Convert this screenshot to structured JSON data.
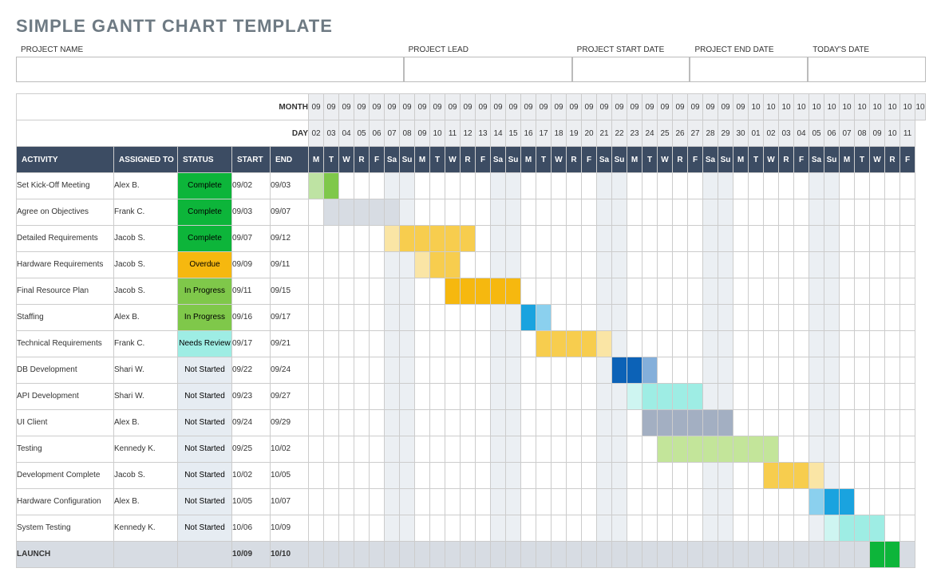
{
  "title": "SIMPLE GANTT CHART TEMPLATE",
  "meta_labels": {
    "project_name": "PROJECT NAME",
    "project_lead": "PROJECT LEAD",
    "start_date": "PROJECT START DATE",
    "end_date": "PROJECT END DATE",
    "today": "TODAY'S DATE"
  },
  "row_labels": {
    "month": "MONTH",
    "day": "DAY"
  },
  "column_headers": {
    "activity": "ACTIVITY",
    "assigned": "ASSIGNED TO",
    "status": "STATUS",
    "start": "START",
    "end": "END"
  },
  "status_colors": {
    "Complete": "#0db53a",
    "Overdue": "#f6b80f",
    "In Progress": "#7fc84a",
    "Needs Review": "#9eede4",
    "Not Started": "#e6ecf2"
  },
  "chart_data": {
    "type": "bar",
    "timeline": {
      "start": "09/02",
      "end": "10/11",
      "months": [
        "09",
        "09",
        "09",
        "09",
        "09",
        "09",
        "09",
        "09",
        "09",
        "09",
        "09",
        "09",
        "09",
        "09",
        "09",
        "09",
        "09",
        "09",
        "09",
        "09",
        "09",
        "09",
        "09",
        "09",
        "09",
        "09",
        "09",
        "09",
        "09",
        "10",
        "10",
        "10",
        "10",
        "10",
        "10",
        "10",
        "10",
        "10",
        "10",
        "10",
        "10"
      ],
      "days": [
        "02",
        "03",
        "04",
        "05",
        "06",
        "07",
        "08",
        "09",
        "10",
        "11",
        "12",
        "13",
        "14",
        "15",
        "16",
        "17",
        "18",
        "19",
        "20",
        "21",
        "22",
        "23",
        "24",
        "25",
        "26",
        "27",
        "28",
        "29",
        "30",
        "01",
        "02",
        "03",
        "04",
        "05",
        "06",
        "07",
        "08",
        "09",
        "10",
        "11"
      ],
      "dow": [
        "M",
        "T",
        "W",
        "R",
        "F",
        "Sa",
        "Su",
        "M",
        "T",
        "W",
        "R",
        "F",
        "Sa",
        "Su",
        "M",
        "T",
        "W",
        "R",
        "F",
        "Sa",
        "Su",
        "M",
        "T",
        "W",
        "R",
        "F",
        "Sa",
        "Su",
        "M",
        "T",
        "W",
        "R",
        "F",
        "Sa",
        "Su",
        "M",
        "T",
        "W",
        "R",
        "F"
      ]
    },
    "weekend_idx": [
      5,
      6,
      12,
      13,
      19,
      20,
      26,
      27,
      33,
      34
    ],
    "tasks": [
      {
        "activity": "Set Kick-Off Meeting",
        "assigned": "Alex B.",
        "status": "Complete",
        "start": "09/02",
        "end": "09/03",
        "bar_start": 0,
        "bar_len": 2,
        "color": "#7fc84a",
        "fade": [
          0
        ]
      },
      {
        "activity": "Agree on Objectives",
        "assigned": "Frank C.",
        "status": "Complete",
        "start": "09/03",
        "end": "09/07",
        "bar_start": 1,
        "bar_len": 5,
        "color": "#d7dce3",
        "fade": []
      },
      {
        "activity": "Detailed Requirements",
        "assigned": "Jacob S.",
        "status": "Complete",
        "start": "09/07",
        "end": "09/12",
        "bar_start": 5,
        "bar_len": 6,
        "color": "#f7cd4e",
        "fade": [
          0
        ]
      },
      {
        "activity": "Hardware Requirements",
        "assigned": "Jacob S.",
        "status": "Overdue",
        "start": "09/09",
        "end": "09/11",
        "bar_start": 7,
        "bar_len": 3,
        "color": "#f7cd4e",
        "fade": [
          0
        ]
      },
      {
        "activity": "Final Resource Plan",
        "assigned": "Jacob S.",
        "status": "In Progress",
        "start": "09/11",
        "end": "09/15",
        "bar_start": 9,
        "bar_len": 5,
        "color": "#f6b80f",
        "fade": []
      },
      {
        "activity": "Staffing",
        "assigned": "Alex B.",
        "status": "In Progress",
        "start": "09/16",
        "end": "09/17",
        "bar_start": 14,
        "bar_len": 2,
        "color": "#1aa3df",
        "fade": [
          1
        ]
      },
      {
        "activity": "Technical Requirements",
        "assigned": "Frank C.",
        "status": "Needs Review",
        "start": "09/17",
        "end": "09/21",
        "bar_start": 15,
        "bar_len": 5,
        "color": "#f7cd4e",
        "fade": [
          4
        ]
      },
      {
        "activity": "DB Development",
        "assigned": "Shari W.",
        "status": "Not Started",
        "start": "09/22",
        "end": "09/24",
        "bar_start": 20,
        "bar_len": 3,
        "color": "#0c62b7",
        "fade": [
          2
        ]
      },
      {
        "activity": "API Development",
        "assigned": "Shari W.",
        "status": "Not Started",
        "start": "09/23",
        "end": "09/27",
        "bar_start": 21,
        "bar_len": 5,
        "color": "#9eede4",
        "fade": [
          0
        ]
      },
      {
        "activity": "UI Client",
        "assigned": "Alex B.",
        "status": "Not Started",
        "start": "09/24",
        "end": "09/29",
        "bar_start": 22,
        "bar_len": 6,
        "color": "#a3afc2",
        "fade": []
      },
      {
        "activity": "Testing",
        "assigned": "Kennedy K.",
        "status": "Not Started",
        "start": "09/25",
        "end": "10/02",
        "bar_start": 23,
        "bar_len": 8,
        "color": "#c3e59a",
        "fade": []
      },
      {
        "activity": "Development Complete",
        "assigned": "Jacob S.",
        "status": "Not Started",
        "start": "10/02",
        "end": "10/05",
        "bar_start": 30,
        "bar_len": 4,
        "color": "#f7cd4e",
        "fade": [
          3
        ]
      },
      {
        "activity": "Hardware Configuration",
        "assigned": "Alex B.",
        "status": "Not Started",
        "start": "10/05",
        "end": "10/07",
        "bar_start": 33,
        "bar_len": 3,
        "color": "#1aa3df",
        "fade": [
          0
        ]
      },
      {
        "activity": "System Testing",
        "assigned": "Kennedy K.",
        "status": "Not Started",
        "start": "10/06",
        "end": "10/09",
        "bar_start": 34,
        "bar_len": 4,
        "color": "#9eede4",
        "fade": [
          0
        ]
      },
      {
        "activity": "LAUNCH",
        "assigned": "",
        "status": "",
        "start": "10/09",
        "end": "10/10",
        "bar_start": 37,
        "bar_len": 2,
        "color": "#0db53a",
        "fade": [],
        "is_launch": true
      }
    ]
  }
}
